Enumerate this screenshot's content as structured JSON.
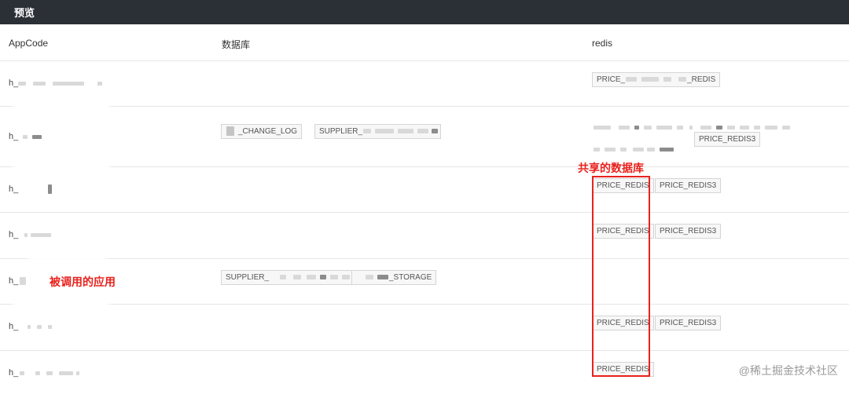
{
  "window": {
    "title": "预览"
  },
  "table": {
    "headers": {
      "appcode": "AppCode",
      "database": "数据库",
      "redis": "redis"
    },
    "rows": [
      {
        "appcode": "h_",
        "db": [],
        "redis": [
          "PRICE_",
          "_REDIS"
        ]
      },
      {
        "appcode": "h_",
        "db": [
          "_CHANGE_LOG",
          "SUPPLIER_"
        ],
        "redis": [
          "PRICE_REDIS3"
        ]
      },
      {
        "appcode": "h_",
        "db": [],
        "redis": [
          "PRICE_REDIS",
          "PRICE_REDIS3"
        ]
      },
      {
        "appcode": "h_",
        "db": [],
        "redis": [
          "PRICE_REDIS",
          "PRICE_REDIS3"
        ]
      },
      {
        "appcode": "h_",
        "db": [
          "SUPPLIER_",
          "_STORAGE"
        ],
        "redis": []
      },
      {
        "appcode": "h_",
        "db": [],
        "redis": [
          "PRICE_REDIS",
          "PRICE_REDIS3"
        ]
      },
      {
        "appcode": "h_",
        "db": [],
        "redis": [
          "PRICE_REDIS"
        ]
      }
    ]
  },
  "annotations": {
    "shared_db": "共享的数据库",
    "called_app": "被调用的应用"
  },
  "watermark": "@稀土掘金技术社区",
  "colors": {
    "titlebar": "#2b2f36",
    "annotation": "#e8221d",
    "border": "#e6e6e6"
  }
}
